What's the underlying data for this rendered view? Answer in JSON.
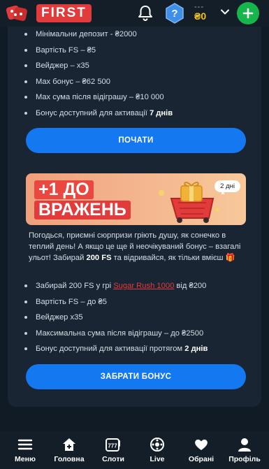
{
  "header": {
    "logo_text": "FIRST",
    "balance_dash": "---",
    "balance_amount": "₴0"
  },
  "top_list": [
    {
      "text": "Мінімальни депозит - ₴2000"
    },
    {
      "text": "Вартість FS – ₴5"
    },
    {
      "text": "Вейджер – x35"
    },
    {
      "text": "Max бонус – ₴62 500"
    },
    {
      "text": "Max сума після відіграшу – ₴10 000"
    },
    {
      "pre": "Бонус доступний для активації ",
      "bold": "7 днів"
    }
  ],
  "start_button": "ПОЧАТИ",
  "banner": {
    "line1": "+1 ДО",
    "line2": "ВРАЖЕНЬ",
    "badge": "2 дні"
  },
  "description": {
    "part1": "Погодься, приємні сюрпризи гріють душу, як сонечко в теплий день! А якщо це ще й неочікуваний бонус – взагалі ульот! Забирай ",
    "bold": "200 FS",
    "part2": " та відривайся, як тільки вмієш 🎁"
  },
  "bottom_list": [
    {
      "pre": "Забирай 200 FS у грі ",
      "link": "Sugar Rush 1000",
      "post": " від ₴200"
    },
    {
      "text": "Вартість FS – до ₴5"
    },
    {
      "text": "Вейджер x35"
    },
    {
      "text": "Максимальна сума після відіграшу – до ₴2500"
    },
    {
      "pre": "Бонус доступний для активації протягом ",
      "bold": "2 днів"
    }
  ],
  "claim_button": "ЗАБРАТИ БОНУС",
  "nav": [
    {
      "label": "Меню",
      "icon": "menu-icon"
    },
    {
      "label": "Головна",
      "icon": "home-icon"
    },
    {
      "label": "Слоти",
      "icon": "slots-icon"
    },
    {
      "label": "Live",
      "icon": "live-icon"
    },
    {
      "label": "Обрані",
      "icon": "heart-icon"
    },
    {
      "label": "Профіль",
      "icon": "profile-icon"
    }
  ],
  "colors": {
    "accent": "#1479f0",
    "brand": "#e23b3b",
    "balance": "#f4c21b",
    "add": "#16b64a"
  }
}
